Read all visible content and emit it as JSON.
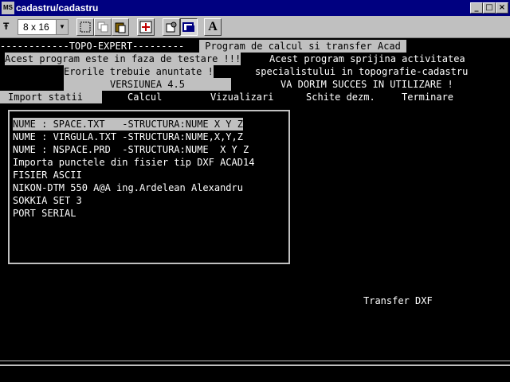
{
  "window": {
    "title": "cadastru/cadastru",
    "icon_text": "MS",
    "minimize": "_",
    "maximize": "□",
    "close": "×"
  },
  "toolbar": {
    "font_icon": "Ŧ",
    "font_size": "8 x 16",
    "buttons": [
      "mark-icon",
      "copy-icon",
      "paste-icon",
      "fullscreen-icon",
      "properties-icon",
      "background-icon",
      "font-icon"
    ],
    "font_button_label": "A"
  },
  "header": {
    "line1_left": "------------TOPO-EXPERT---------",
    "line1_right": " Program de calcul si transfer Acad ",
    "line2_left": "Acest program este in faza de testare !!!",
    "line2_right": "Acest program sprijina activitatea",
    "line3_left": "Erorile trebuie anuntate !",
    "line3_right": "specialistului in topografie-cadastru",
    "line4_left": "VERSIUNEA 4.5",
    "line4_right": "VA DORIM SUCCES IN UTILIZARE !"
  },
  "menu": [
    "Import statii",
    "Calcul",
    "Vizualizari",
    "Schite dezm.",
    "Terminare"
  ],
  "list": [
    "NUME : SPACE.TXT   -STRUCTURA:NUME X Y Z",
    "NUME : VIRGULA.TXT -STRUCTURA:NUME,X,Y,Z",
    "NUME : NSPACE.PRD  -STRUCTURA:NUME  X Y Z",
    "Importa punctele din fisier tip DXF ACAD14",
    "FISIER ASCII",
    "NIKON-DTM 550 A@A ing.Ardelean Alexandru",
    "SOKKIA SET 3",
    "PORT SERIAL"
  ],
  "status_text": "Transfer DXF",
  "colors": {
    "titlebar": "#000080",
    "panel": "#c0c0c0",
    "screen": "#000000"
  }
}
